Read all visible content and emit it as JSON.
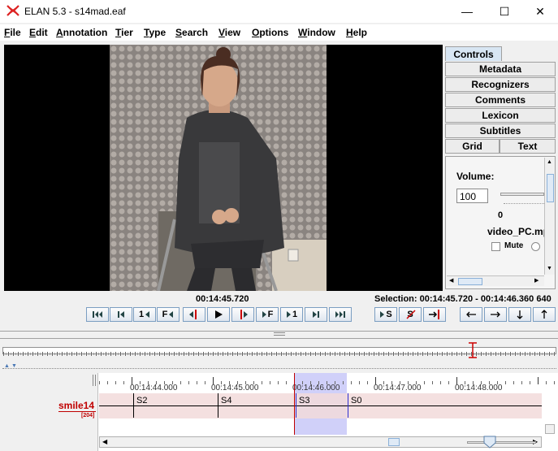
{
  "window": {
    "title": "ELAN 5.3 - s14mad.eaf",
    "minimize_glyph": "—",
    "maximize_glyph": "☐",
    "close_glyph": "✕"
  },
  "menu": [
    {
      "label": "File",
      "mnemonic": "F",
      "rest": "ile"
    },
    {
      "label": "Edit",
      "mnemonic": "E",
      "rest": "dit"
    },
    {
      "label": "Annotation",
      "mnemonic": "A",
      "rest": "nnotation"
    },
    {
      "label": "Tier",
      "mnemonic": "T",
      "rest": "ier"
    },
    {
      "label": "Type",
      "mnemonic": "T",
      "rest": "ype"
    },
    {
      "label": "Search",
      "mnemonic": "S",
      "rest": "earch"
    },
    {
      "label": "View",
      "mnemonic": "V",
      "rest": "iew"
    },
    {
      "label": "Options",
      "mnemonic": "O",
      "rest": "ptions"
    },
    {
      "label": "Window",
      "mnemonic": "W",
      "rest": "indow"
    },
    {
      "label": "Help",
      "mnemonic": "H",
      "rest": "elp"
    }
  ],
  "tabs": {
    "controls": "Controls",
    "metadata": "Metadata",
    "recognizers": "Recognizers",
    "comments": "Comments",
    "lexicon": "Lexicon",
    "subtitles": "Subtitles",
    "grid": "Grid",
    "text": "Text"
  },
  "controls_panel": {
    "volume_label": "Volume:",
    "volume_value": "100",
    "slider_min": "0",
    "file_name": "video_PC.mp",
    "mute_label": "Mute"
  },
  "playback": {
    "current_time": "00:14:45.720",
    "selection": "Selection: 00:14:45.720 - 00:14:46.360  640"
  },
  "transport_buttons": {
    "b4": "1",
    "b5": "F",
    "b8": "F",
    "b9": "1",
    "b11": "S",
    "b12": "S"
  },
  "timeline": {
    "ruler": [
      "00:14:44.000",
      "00:14:45.000",
      "00:14:46.000",
      "00:14:47.000",
      "00:14:48.000"
    ],
    "tier": {
      "name": "smile14",
      "count": "[204]"
    },
    "annotations": [
      "S2",
      "S4",
      "S3",
      "S0"
    ]
  },
  "colors": {
    "accent": "#4a78b5",
    "tier_red": "#c00000",
    "selection": "#c8c8f8",
    "tier_band": "#f2dada"
  }
}
